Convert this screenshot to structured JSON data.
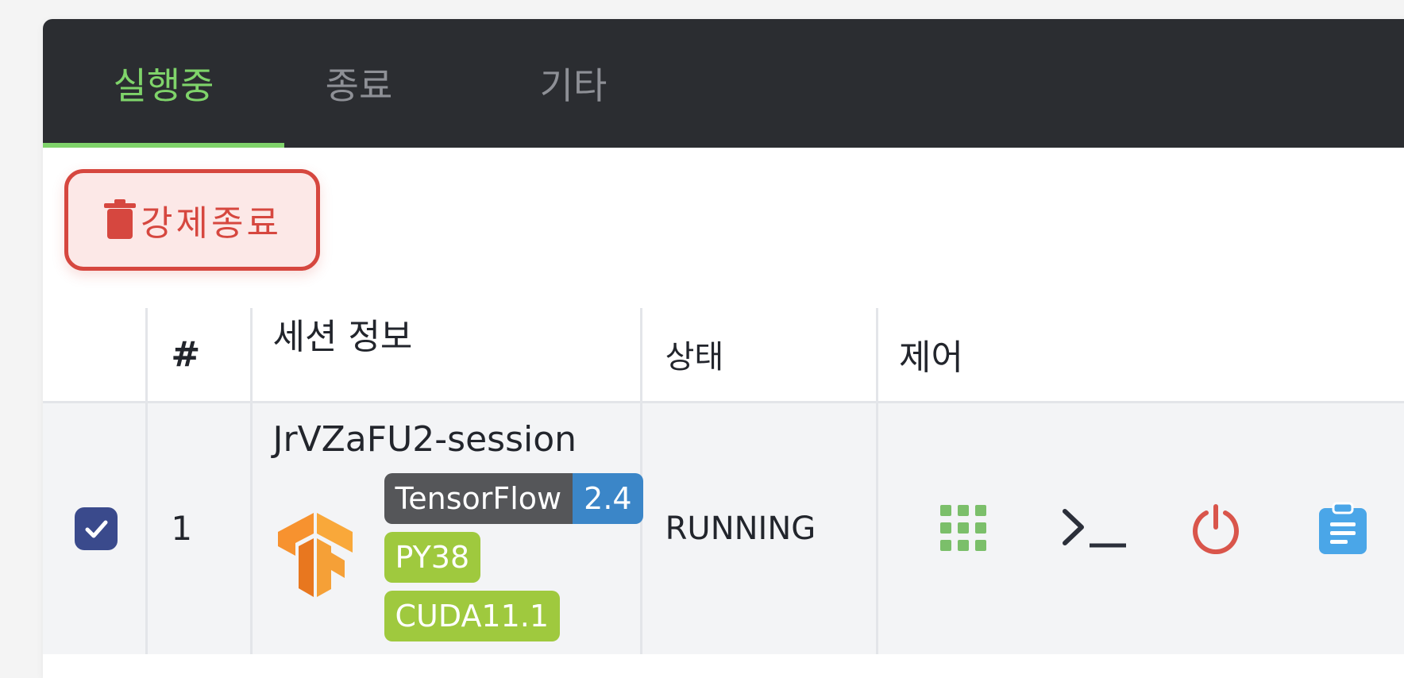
{
  "tabs": [
    {
      "label": "실행중",
      "active": true
    },
    {
      "label": "종료",
      "active": false
    },
    {
      "label": "기타",
      "active": false
    }
  ],
  "toolbar": {
    "terminate_label": "강제종료"
  },
  "table": {
    "headers": {
      "number": "#",
      "session_info": "세션 정보",
      "status": "상태",
      "control": "제어"
    },
    "rows": [
      {
        "checked": true,
        "number": "1",
        "session_name": "JrVZaFU2-session",
        "framework": {
          "name": "TensorFlow",
          "version": "2.4"
        },
        "tags": [
          "PY38",
          "CUDA11.1"
        ],
        "status": "RUNNING",
        "controls": [
          "apps-icon",
          "terminal-icon",
          "power-icon",
          "clipboard-icon"
        ]
      }
    ]
  },
  "colors": {
    "accent": "#7fd36a",
    "danger": "#d6473f",
    "checkbox": "#3a4a8c",
    "tag_green": "#9fc93e",
    "tag_blue": "#3b86c8"
  }
}
